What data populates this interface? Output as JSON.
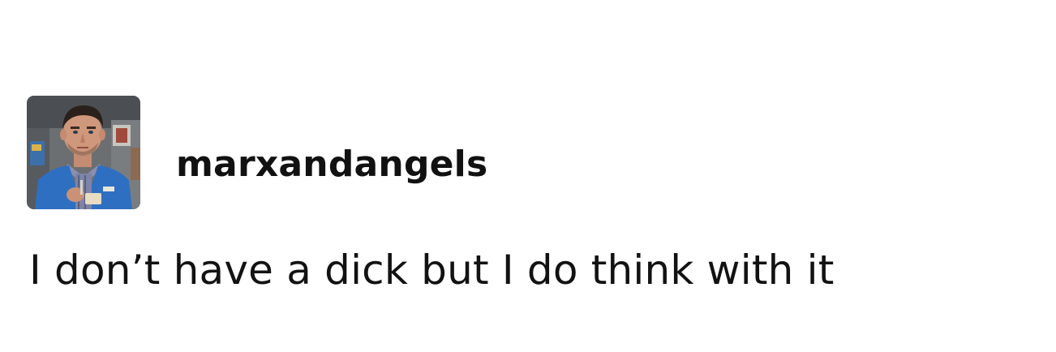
{
  "post": {
    "username": "marxandangels",
    "text": "I don’t have a dick but I do think with it"
  }
}
